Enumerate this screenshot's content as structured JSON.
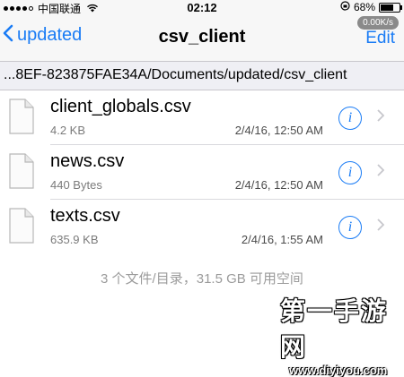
{
  "status_bar": {
    "carrier": "中国联通",
    "time": "02:12",
    "battery_percent": "68%",
    "battery_level": 0.68,
    "signal_dots_filled": 4,
    "signal_dots_total": 5
  },
  "speed_badge": "0.00K/s",
  "nav": {
    "back_label": "updated",
    "title": "csv_client",
    "edit_label": "Edit"
  },
  "path": "...8EF-823875FAE34A/Documents/updated/csv_client",
  "files": [
    {
      "name": "client_globals.csv",
      "size": "4.2 KB",
      "date": "2/4/16, 12:50 AM"
    },
    {
      "name": "news.csv",
      "size": "440 Bytes",
      "date": "2/4/16, 12:50 AM"
    },
    {
      "name": "texts.csv",
      "size": "635.9 KB",
      "date": "2/4/16, 1:55 AM"
    }
  ],
  "footer": "3 个文件/目录，31.5 GB 可用空间",
  "watermark": {
    "title": "第一手游网",
    "url": "www.diyiyou.com"
  },
  "colors": {
    "accent": "#1a7cf5",
    "background": "#ffffff",
    "path_bar": "#efeff4"
  },
  "icons": {
    "back": "chevron-left-icon",
    "file": "document-icon",
    "info": "info-icon",
    "disclosure": "chevron-right-icon",
    "wifi": "wifi-icon",
    "lock": "rotation-lock-icon",
    "battery": "battery-icon"
  }
}
